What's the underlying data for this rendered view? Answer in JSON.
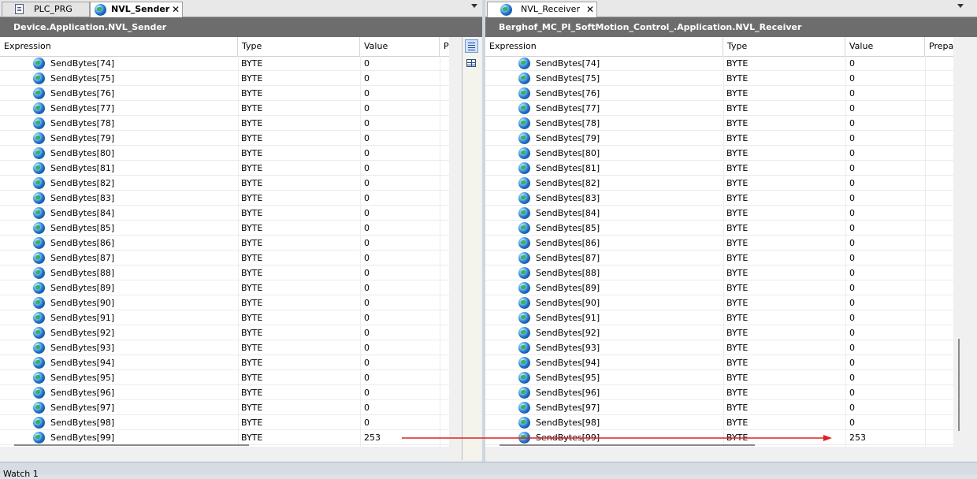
{
  "left": {
    "tabs": [
      {
        "label": "PLC_PRG",
        "icon": "document-icon",
        "active": false
      },
      {
        "label": "NVL_Sender",
        "icon": "globe-icon",
        "active": true,
        "close": "✕"
      }
    ],
    "title": "Device.Application.NVL_Sender",
    "columns": {
      "expression": "Expression",
      "type": "Type",
      "value": "Value",
      "prepared": "P"
    },
    "rows": [
      {
        "expression": "SendBytes[74]",
        "type": "BYTE",
        "value": "0"
      },
      {
        "expression": "SendBytes[75]",
        "type": "BYTE",
        "value": "0"
      },
      {
        "expression": "SendBytes[76]",
        "type": "BYTE",
        "value": "0"
      },
      {
        "expression": "SendBytes[77]",
        "type": "BYTE",
        "value": "0"
      },
      {
        "expression": "SendBytes[78]",
        "type": "BYTE",
        "value": "0"
      },
      {
        "expression": "SendBytes[79]",
        "type": "BYTE",
        "value": "0"
      },
      {
        "expression": "SendBytes[80]",
        "type": "BYTE",
        "value": "0"
      },
      {
        "expression": "SendBytes[81]",
        "type": "BYTE",
        "value": "0"
      },
      {
        "expression": "SendBytes[82]",
        "type": "BYTE",
        "value": "0"
      },
      {
        "expression": "SendBytes[83]",
        "type": "BYTE",
        "value": "0"
      },
      {
        "expression": "SendBytes[84]",
        "type": "BYTE",
        "value": "0"
      },
      {
        "expression": "SendBytes[85]",
        "type": "BYTE",
        "value": "0"
      },
      {
        "expression": "SendBytes[86]",
        "type": "BYTE",
        "value": "0"
      },
      {
        "expression": "SendBytes[87]",
        "type": "BYTE",
        "value": "0"
      },
      {
        "expression": "SendBytes[88]",
        "type": "BYTE",
        "value": "0"
      },
      {
        "expression": "SendBytes[89]",
        "type": "BYTE",
        "value": "0"
      },
      {
        "expression": "SendBytes[90]",
        "type": "BYTE",
        "value": "0"
      },
      {
        "expression": "SendBytes[91]",
        "type": "BYTE",
        "value": "0"
      },
      {
        "expression": "SendBytes[92]",
        "type": "BYTE",
        "value": "0"
      },
      {
        "expression": "SendBytes[93]",
        "type": "BYTE",
        "value": "0"
      },
      {
        "expression": "SendBytes[94]",
        "type": "BYTE",
        "value": "0"
      },
      {
        "expression": "SendBytes[95]",
        "type": "BYTE",
        "value": "0"
      },
      {
        "expression": "SendBytes[96]",
        "type": "BYTE",
        "value": "0"
      },
      {
        "expression": "SendBytes[97]",
        "type": "BYTE",
        "value": "0"
      },
      {
        "expression": "SendBytes[98]",
        "type": "BYTE",
        "value": "0"
      },
      {
        "expression": "SendBytes[99]",
        "type": "BYTE",
        "value": "253"
      }
    ]
  },
  "right": {
    "tabs": [
      {
        "label": "NVL_Receiver",
        "icon": "globe-icon",
        "active": false,
        "close": "✕"
      }
    ],
    "title": "Berghof_MC_PI_SoftMotion_Control_.Application.NVL_Receiver",
    "columns": {
      "expression": "Expression",
      "type": "Type",
      "value": "Value",
      "prepared": "Prepa"
    },
    "rows": [
      {
        "expression": "SendBytes[74]",
        "type": "BYTE",
        "value": "0"
      },
      {
        "expression": "SendBytes[75]",
        "type": "BYTE",
        "value": "0"
      },
      {
        "expression": "SendBytes[76]",
        "type": "BYTE",
        "value": "0"
      },
      {
        "expression": "SendBytes[77]",
        "type": "BYTE",
        "value": "0"
      },
      {
        "expression": "SendBytes[78]",
        "type": "BYTE",
        "value": "0"
      },
      {
        "expression": "SendBytes[79]",
        "type": "BYTE",
        "value": "0"
      },
      {
        "expression": "SendBytes[80]",
        "type": "BYTE",
        "value": "0"
      },
      {
        "expression": "SendBytes[81]",
        "type": "BYTE",
        "value": "0"
      },
      {
        "expression": "SendBytes[82]",
        "type": "BYTE",
        "value": "0"
      },
      {
        "expression": "SendBytes[83]",
        "type": "BYTE",
        "value": "0"
      },
      {
        "expression": "SendBytes[84]",
        "type": "BYTE",
        "value": "0"
      },
      {
        "expression": "SendBytes[85]",
        "type": "BYTE",
        "value": "0"
      },
      {
        "expression": "SendBytes[86]",
        "type": "BYTE",
        "value": "0"
      },
      {
        "expression": "SendBytes[87]",
        "type": "BYTE",
        "value": "0"
      },
      {
        "expression": "SendBytes[88]",
        "type": "BYTE",
        "value": "0"
      },
      {
        "expression": "SendBytes[89]",
        "type": "BYTE",
        "value": "0"
      },
      {
        "expression": "SendBytes[90]",
        "type": "BYTE",
        "value": "0"
      },
      {
        "expression": "SendBytes[91]",
        "type": "BYTE",
        "value": "0"
      },
      {
        "expression": "SendBytes[92]",
        "type": "BYTE",
        "value": "0"
      },
      {
        "expression": "SendBytes[93]",
        "type": "BYTE",
        "value": "0"
      },
      {
        "expression": "SendBytes[94]",
        "type": "BYTE",
        "value": "0"
      },
      {
        "expression": "SendBytes[95]",
        "type": "BYTE",
        "value": "0"
      },
      {
        "expression": "SendBytes[96]",
        "type": "BYTE",
        "value": "0"
      },
      {
        "expression": "SendBytes[97]",
        "type": "BYTE",
        "value": "0"
      },
      {
        "expression": "SendBytes[98]",
        "type": "BYTE",
        "value": "0"
      },
      {
        "expression": "SendBytes[99]",
        "type": "BYTE",
        "value": "253"
      }
    ]
  },
  "bottom_panel": {
    "label": "Watch 1"
  },
  "annotation": {
    "color": "#e02020",
    "shape": "arrow"
  }
}
